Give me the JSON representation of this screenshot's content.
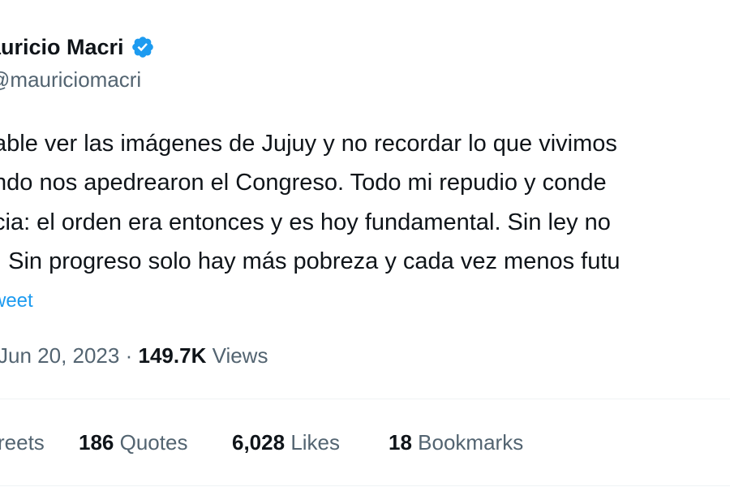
{
  "author": {
    "name": "auricio Macri",
    "handle": "mauriciomacri",
    "verified_color": "#1d9bf0"
  },
  "tweet": {
    "lines": [
      "able ver las imágenes de Jujuy y no recordar lo que vivimos",
      "ndo nos apedrearon el Congreso. Todo mi repudio y conde",
      "cia: el orden era entonces y es hoy fundamental. Sin ley no",
      ". Sin progreso solo hay más pobreza y cada vez menos futu"
    ],
    "translate_label": "weet"
  },
  "meta": {
    "date": "Jun 20, 2023",
    "separator": "·",
    "views_count": "149.7K",
    "views_label": "Views"
  },
  "stats": {
    "retweets_label": "reets",
    "quotes_count": "186",
    "quotes_label": "Quotes",
    "likes_count": "6,028",
    "likes_label": "Likes",
    "bookmarks_count": "18",
    "bookmarks_label": "Bookmarks"
  },
  "colors": {
    "text_primary": "#0f1419",
    "text_secondary": "#536471",
    "link": "#1d9bf0",
    "divider": "#eff3f4"
  }
}
